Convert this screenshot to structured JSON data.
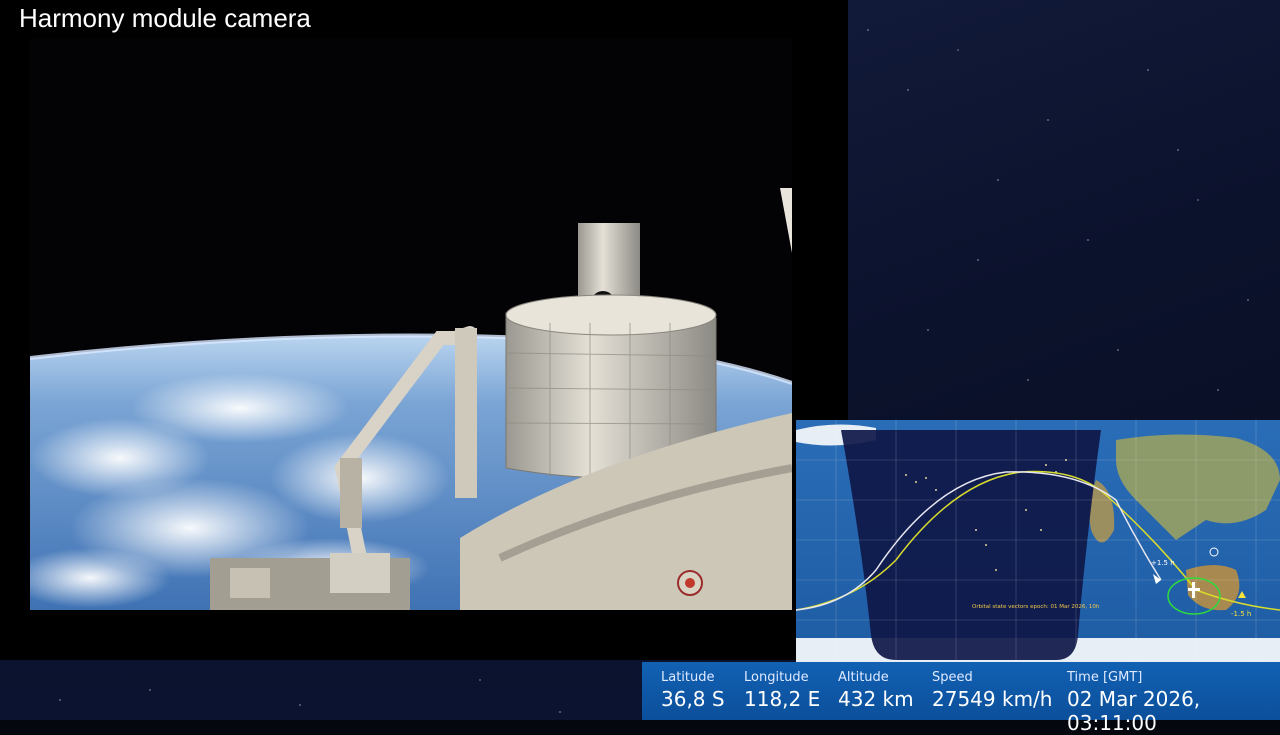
{
  "header": {
    "title": "Harmony module camera"
  },
  "map": {
    "epoch_text": "Orbital state vectors epoch: 01 Mar 2026, 10h",
    "marker_plus": "+1.5 h",
    "marker_minus": "-1.5 h"
  },
  "telemetry": [
    {
      "label": "Latitude",
      "value": "36,8 S"
    },
    {
      "label": "Longitude",
      "value": "118,2 E"
    },
    {
      "label": "Altitude",
      "value": "432 km"
    },
    {
      "label": "Speed",
      "value": "27549 km/h"
    },
    {
      "label": "Time [GMT]",
      "value": "02 Mar 2026, 03:11:00"
    }
  ]
}
